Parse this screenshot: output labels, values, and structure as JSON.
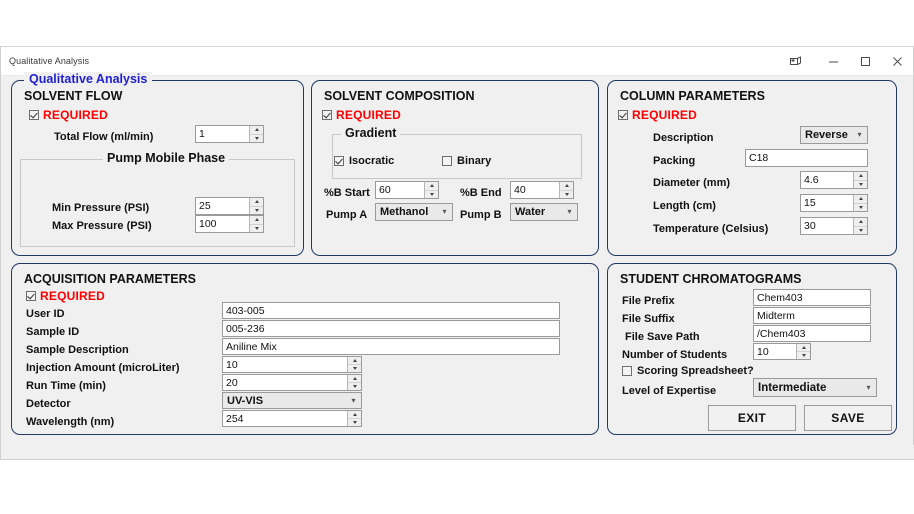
{
  "window": {
    "title": "Qualitative Analysis",
    "controls": {
      "restore_extra": "restore-window-icon",
      "minimize": "–",
      "maximize": "☐",
      "close": "✕"
    }
  },
  "outer_group": {
    "legend": "Qualitative Analysis"
  },
  "panels": {
    "solvent_flow": {
      "legend": "SOLVENT FLOW",
      "required_label": "REQUIRED",
      "required_checked": true,
      "total_flow_label": "Total Flow (ml/min)",
      "total_flow_value": "1",
      "pump_mobile_phase_legend": "Pump Mobile Phase",
      "min_pressure_label": "Min Pressure (PSI)",
      "min_pressure_value": "25",
      "max_pressure_label": "Max Pressure (PSI)",
      "max_pressure_value": "100"
    },
    "solvent_composition": {
      "legend": "SOLVENT COMPOSITION",
      "required_label": "REQUIRED",
      "required_checked": true,
      "gradient_legend": "Gradient",
      "isocratic_label": "Isocratic",
      "isocratic_checked": true,
      "binary_label": "Binary",
      "binary_checked": false,
      "pct_b_start_label": "%B Start",
      "pct_b_start_value": "60",
      "pct_b_end_label": "%B End",
      "pct_b_end_value": "40",
      "pump_a_label": "Pump A",
      "pump_a_value": "Methanol",
      "pump_b_label": "Pump B",
      "pump_b_value": "Water"
    },
    "column_parameters": {
      "legend": "COLUMN PARAMETERS",
      "required_label": "REQUIRED",
      "required_checked": true,
      "description_label": "Description",
      "description_value": "Reverse",
      "packing_label": "Packing",
      "packing_value": "C18",
      "diameter_label": "Diameter (mm)",
      "diameter_value": "4.6",
      "length_label": "Length (cm)",
      "length_value": "15",
      "temperature_label": "Temperature (Celsius)",
      "temperature_value": "30"
    },
    "acquisition_parameters": {
      "legend": "ACQUISITION PARAMETERS",
      "required_label": "REQUIRED",
      "required_checked": true,
      "user_id_label": "User ID",
      "user_id_value": "403-005",
      "sample_id_label": "Sample ID",
      "sample_id_value": "005-236",
      "sample_description_label": "Sample Description",
      "sample_description_value": "Aniline Mix",
      "injection_amount_label": "Injection Amount (microLiter)",
      "injection_amount_value": "10",
      "run_time_label": "Run Time (min)",
      "run_time_value": "20",
      "detector_label": "Detector",
      "detector_value": "UV-VIS",
      "wavelength_label": "Wavelength (nm)",
      "wavelength_value": "254"
    },
    "student_chromatograms": {
      "legend": "STUDENT CHROMATOGRAMS",
      "file_prefix_label": "File Prefix",
      "file_prefix_value": "Chem403",
      "file_suffix_label": "File Suffix",
      "file_suffix_value": "Midterm",
      "file_save_path_label": "File Save Path",
      "file_save_path_value": "/Chem403",
      "number_of_students_label": "Number of Students",
      "number_of_students_value": "10",
      "scoring_spreadsheet_label": "Scoring Spreadsheet?",
      "scoring_spreadsheet_checked": false,
      "level_of_expertise_label": "Level of Expertise",
      "level_of_expertise_value": "Intermediate",
      "exit_button": "EXIT",
      "save_button": "SAVE"
    }
  },
  "colors": {
    "panel_border": "#1f3864",
    "legend_blue": "#1f1fd0",
    "required_red": "#ff0000",
    "window_bg": "#f0f0f0"
  }
}
